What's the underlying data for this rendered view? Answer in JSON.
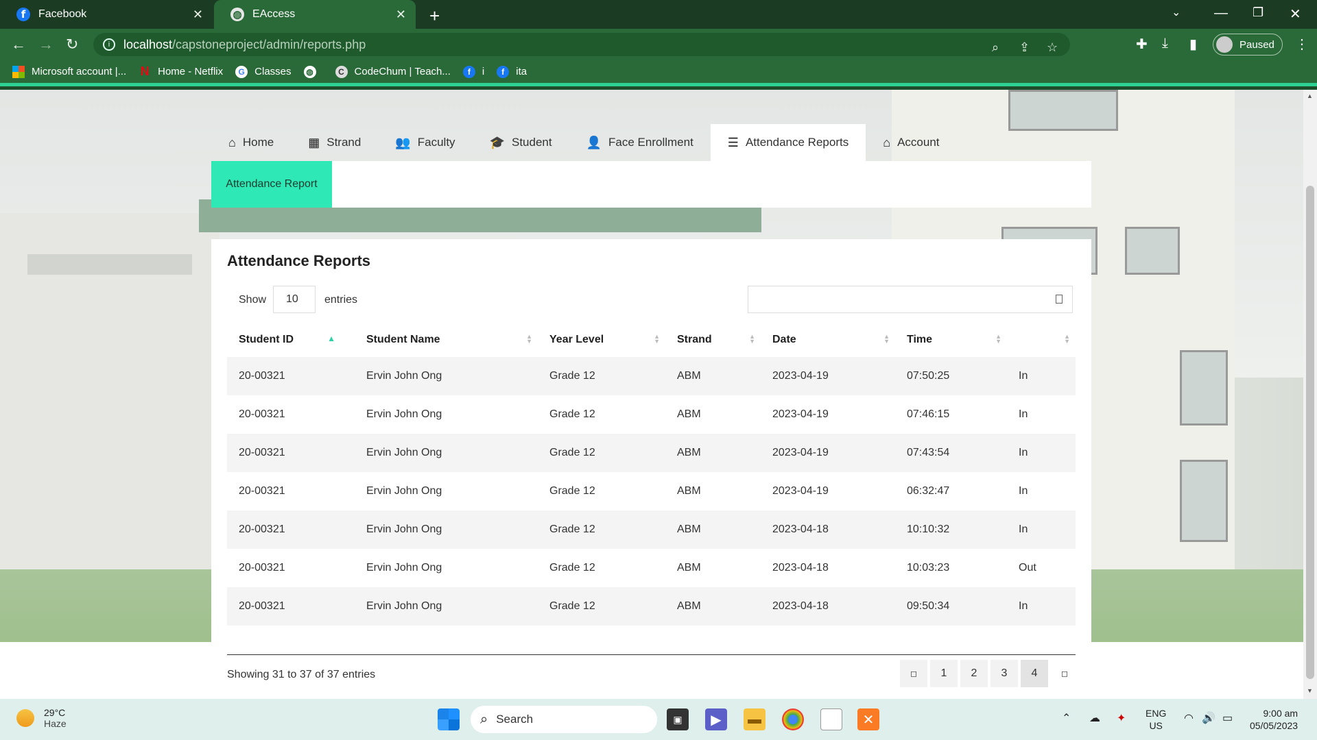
{
  "browser": {
    "tabs": [
      {
        "title": "Facebook",
        "icon": "facebook-icon"
      },
      {
        "title": "EAccess",
        "icon": "globe-icon"
      }
    ],
    "url_host": "localhost",
    "url_path": "/capstoneproject/admin/reports.php",
    "profile_label": "Paused",
    "bookmarks": [
      {
        "label": "Microsoft account |...",
        "icon": "microsoft-icon"
      },
      {
        "label": "Home - Netflix",
        "icon": "netflix-icon"
      },
      {
        "label": "Classes",
        "icon": "google-icon"
      },
      {
        "label": "",
        "icon": "globe-icon"
      },
      {
        "label": "CodeChum | Teach...",
        "icon": "codechum-icon"
      },
      {
        "label": "i",
        "icon": "facebook-icon"
      },
      {
        "label": "ita",
        "icon": "facebook-icon"
      }
    ]
  },
  "nav": {
    "items": [
      {
        "label": "Home",
        "icon": "home-icon"
      },
      {
        "label": "Strand",
        "icon": "building-icon"
      },
      {
        "label": "Faculty",
        "icon": "users-icon"
      },
      {
        "label": "Student",
        "icon": "graduation-cap-icon"
      },
      {
        "label": "Face Enrollment",
        "icon": "user-plus-icon"
      },
      {
        "label": "Attendance Reports",
        "icon": "chart-icon",
        "active": true
      },
      {
        "label": "Account",
        "icon": "account-icon"
      }
    ],
    "sub_active": "Attendance Report"
  },
  "report": {
    "title": "Attendance Reports",
    "show_label": "Show",
    "entries_value": "10",
    "entries_label": "entries",
    "columns": [
      "Student ID",
      "Student Name",
      "Year Level",
      "Strand",
      "Date",
      "Time",
      ""
    ],
    "rows": [
      [
        "20-00321",
        "Ervin John Ong",
        "Grade 12",
        "ABM",
        "2023-04-19",
        "07:50:25",
        "In"
      ],
      [
        "20-00321",
        "Ervin John Ong",
        "Grade 12",
        "ABM",
        "2023-04-19",
        "07:46:15",
        "In"
      ],
      [
        "20-00321",
        "Ervin John Ong",
        "Grade 12",
        "ABM",
        "2023-04-19",
        "07:43:54",
        "In"
      ],
      [
        "20-00321",
        "Ervin John Ong",
        "Grade 12",
        "ABM",
        "2023-04-19",
        "06:32:47",
        "In"
      ],
      [
        "20-00321",
        "Ervin John Ong",
        "Grade 12",
        "ABM",
        "2023-04-18",
        "10:10:32",
        "In"
      ],
      [
        "20-00321",
        "Ervin John Ong",
        "Grade 12",
        "ABM",
        "2023-04-18",
        "10:03:23",
        "Out"
      ],
      [
        "20-00321",
        "Ervin John Ong",
        "Grade 12",
        "ABM",
        "2023-04-18",
        "09:50:34",
        "In"
      ]
    ],
    "info": "Showing 31 to 37 of 37 entries",
    "pages": [
      "1",
      "2",
      "3",
      "4"
    ],
    "current_page": "4"
  },
  "taskbar": {
    "temperature": "29°C",
    "weather": "Haze",
    "search_label": "Search",
    "lang_top": "ENG",
    "lang_bottom": "US",
    "time": "9:00 am",
    "date": "05/05/2023"
  },
  "colors": {
    "browser_green": "#2a6a38",
    "accent_mint": "#2ee8b6",
    "bookmark_underline": "#2ed194"
  }
}
